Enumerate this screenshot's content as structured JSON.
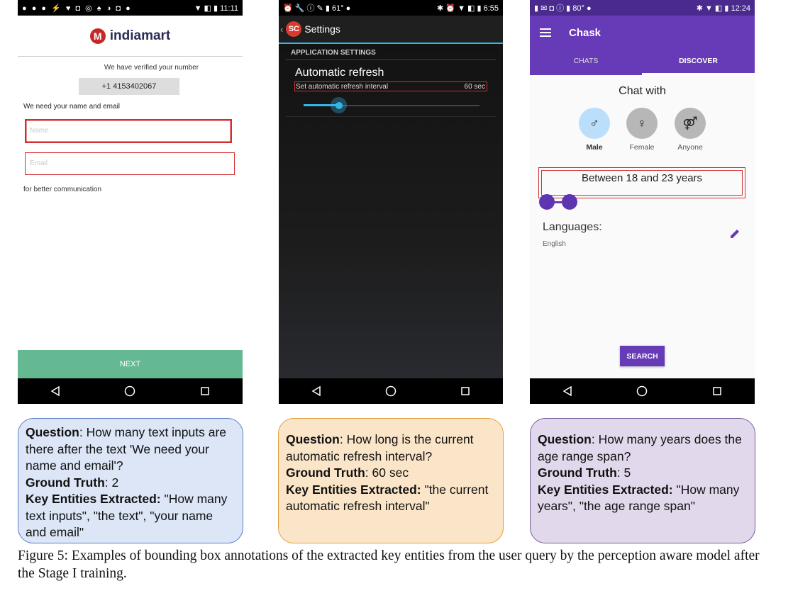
{
  "panel1": {
    "status_time": "11:11",
    "app_name": "indiamart",
    "logo_letter": "M",
    "verified_text": "We have verified your number",
    "phone": "+1 4153402067",
    "need_text": "We need your name and email",
    "name_placeholder": "Name",
    "email_placeholder": "Email",
    "better_text": "for better communication",
    "next_label": "NEXT",
    "colors": {
      "next_button": "#64b993",
      "bbox": "#d32f2f"
    }
  },
  "panel2": {
    "status_time": "6:55",
    "status_temp": "61°",
    "app_badge": "SC",
    "title": "Settings",
    "section_header": "APPLICATION SETTINGS",
    "pref_title": "Automatic refresh",
    "pref_summary": "Set automatic refresh interval",
    "pref_value": "60 sec",
    "slider_fraction": 0.2,
    "colors": {
      "slider": "#33b5e5",
      "badge": "#d83a2e"
    }
  },
  "panel3": {
    "status_time": "12:24",
    "status_temp": "80°",
    "app_title": "Chask",
    "tabs": [
      "CHATS",
      "DISCOVER"
    ],
    "chat_with": "Chat with",
    "genders": [
      {
        "label": "Male",
        "icon": "male-icon",
        "glyph": "♂"
      },
      {
        "label": "Female",
        "icon": "female-icon",
        "glyph": "♀"
      },
      {
        "label": "Anyone",
        "icon": "anyone-icon",
        "glyph": "⚤"
      }
    ],
    "age_range": "Between 18 and 23 years",
    "languages_label": "Languages:",
    "language_value": "English",
    "search_label": "SEARCH",
    "colors": {
      "primary": "#673ab7",
      "male_selected": "#bbdefb"
    }
  },
  "questions": [
    {
      "question_label": "Question",
      "question": ": How many text inputs are there after the text 'We need your name and email'?",
      "gt_label": "Ground Truth",
      "gt": ": 2",
      "ke_label": "Key Entities Extracted:",
      "ke": " \"How many text inputs\", \"the text\", \"your name and email\""
    },
    {
      "question_label": "Question",
      "question": ": How long is the current automatic refresh interval?",
      "gt_label": "Ground Truth",
      "gt": ": 60 sec",
      "ke_label": "Key Entities Extracted:",
      "ke": " \"the current automatic refresh interval\""
    },
    {
      "question_label": "Question",
      "question": ": How many years does the age range span?",
      "gt_label": "Ground Truth",
      "gt": ": 5",
      "ke_label": "Key Entities Extracted:",
      "ke": " \"How many years\", \"the age range span\""
    }
  ],
  "caption": "Figure 5: Examples of bounding box annotations of the extracted key entities from the user query by the perception aware model after the Stage I training.",
  "box_colors": [
    {
      "fill": "#dce6f7",
      "border": "#5b7fc4"
    },
    {
      "fill": "#fbe5c8",
      "border": "#e0a13c"
    },
    {
      "fill": "#e2d8ec",
      "border": "#7a5e9c"
    }
  ]
}
